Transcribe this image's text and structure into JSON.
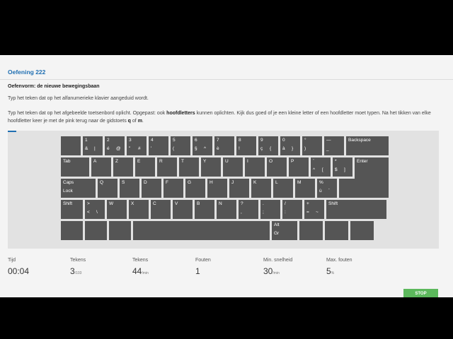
{
  "exercise": {
    "title": "Oefening 222",
    "subtitle": "Oefenvorm: de nieuwe bewegingsbaan",
    "instruction1": "Typ het teken dat op het alfanumerieke klavier aangeduid wordt.",
    "instruction2_a": "Typ het teken dat op het afgebeelde toetsenbord oplicht. Opgepast: ook ",
    "instruction2_b": "hoofdletters",
    "instruction2_c": " kunnen oplichten. Kijk dus goed of je een kleine letter of een hoofdletter moet typen. Na het tikken van elke hoofdletter keer je met de pink terug naar de gidstoets ",
    "instruction2_d": "q",
    "instruction2_e": " of ",
    "instruction2_f": "m",
    "instruction2_g": "."
  },
  "keyboard": {
    "rows": [
      [
        {
          "w": 28,
          "tl": "",
          "bl": ""
        },
        {
          "w": 28,
          "tl": "1",
          "bl": "&",
          "br": "|"
        },
        {
          "w": 28,
          "tl": "2",
          "bl": "é",
          "br": "@"
        },
        {
          "w": 28,
          "tl": "3",
          "bl": "\"",
          "br": "#"
        },
        {
          "w": 28,
          "tl": "4",
          "bl": "'"
        },
        {
          "w": 28,
          "tl": "5",
          "bl": "("
        },
        {
          "w": 28,
          "tl": "6",
          "bl": "§",
          "br": "^"
        },
        {
          "w": 28,
          "tl": "7",
          "bl": "è"
        },
        {
          "w": 28,
          "tl": "8",
          "bl": "!"
        },
        {
          "w": 28,
          "tl": "9",
          "bl": "ç",
          "br": "{"
        },
        {
          "w": 28,
          "tl": "0",
          "bl": "à",
          "br": "}"
        },
        {
          "w": 28,
          "tl": "°",
          "bl": ")"
        },
        {
          "w": 28,
          "tl": "—",
          "bl": "_"
        },
        {
          "w": 60,
          "tl": "Backspace"
        }
      ],
      [
        {
          "w": 40,
          "tl": "Tab"
        },
        {
          "w": 28,
          "tl": "A"
        },
        {
          "w": 28,
          "tl": "Z"
        },
        {
          "w": 28,
          "tl": "E"
        },
        {
          "w": 28,
          "tl": "R"
        },
        {
          "w": 28,
          "tl": "T"
        },
        {
          "w": 28,
          "tl": "Y"
        },
        {
          "w": 28,
          "tl": "U"
        },
        {
          "w": 28,
          "tl": "I"
        },
        {
          "w": 28,
          "tl": "O"
        },
        {
          "w": 28,
          "tl": "P"
        },
        {
          "w": 28,
          "tl": "¨",
          "bl": "^",
          "br": "["
        },
        {
          "w": 28,
          "tl": "*",
          "bl": "$",
          "br": "]"
        },
        {
          "w": 48,
          "tl": "Enter",
          "tall": true
        }
      ],
      [
        {
          "w": 49,
          "tl": "Caps",
          "bl": "Lock"
        },
        {
          "w": 28,
          "tl": "Q"
        },
        {
          "w": 28,
          "tl": "S"
        },
        {
          "w": 28,
          "tl": "D"
        },
        {
          "w": 28,
          "tl": "F"
        },
        {
          "w": 28,
          "tl": "G"
        },
        {
          "w": 28,
          "tl": "H"
        },
        {
          "w": 28,
          "tl": "J"
        },
        {
          "w": 28,
          "tl": "K"
        },
        {
          "w": 28,
          "tl": "L"
        },
        {
          "w": 28,
          "tl": "M"
        },
        {
          "w": 28,
          "tl": "%",
          "bl": "ù",
          "br": "´"
        },
        {
          "w": 28,
          "tl": ""
        }
      ],
      [
        {
          "w": 31,
          "tl": "Shift"
        },
        {
          "w": 28,
          "tl": ">",
          "bl": "<",
          "br": "\\"
        },
        {
          "w": 28,
          "tl": "W"
        },
        {
          "w": 28,
          "tl": "X"
        },
        {
          "w": 28,
          "tl": "C"
        },
        {
          "w": 28,
          "tl": "V"
        },
        {
          "w": 28,
          "tl": "B"
        },
        {
          "w": 28,
          "tl": "N"
        },
        {
          "w": 28,
          "tl": "?",
          "bl": ","
        },
        {
          "w": 28,
          "tl": ".",
          "bl": ";"
        },
        {
          "w": 28,
          "tl": "/",
          "bl": ":"
        },
        {
          "w": 28,
          "tl": "+",
          "bl": "=",
          "br": "~"
        },
        {
          "w": 85,
          "tl": "Shift"
        }
      ],
      [
        {
          "w": 31,
          "tl": ""
        },
        {
          "w": 31,
          "tl": ""
        },
        {
          "w": 31,
          "tl": ""
        },
        {
          "w": 193,
          "tl": ""
        },
        {
          "w": 36,
          "tl": "Alt",
          "bl": "Gr"
        },
        {
          "w": 33,
          "tl": ""
        },
        {
          "w": 33,
          "tl": ""
        },
        {
          "w": 33,
          "tl": ""
        }
      ]
    ]
  },
  "stats": [
    {
      "label": "Tijd",
      "value": "00:04",
      "unit": ""
    },
    {
      "label": "Tekens",
      "value": "3",
      "unit": "/103"
    },
    {
      "label": "Tekens",
      "value": "44",
      "unit": "/min"
    },
    {
      "label": "Fouten",
      "value": "1",
      "unit": ""
    },
    {
      "label": "Min. snelheid",
      "value": "30",
      "unit": "/min"
    },
    {
      "label": "Max. fouten",
      "value": "5",
      "unit": "%"
    }
  ],
  "stop_label": "STOP",
  "colors": {
    "accent": "#1f6fb2",
    "key": "#555555",
    "stop": "#5cb85c"
  }
}
